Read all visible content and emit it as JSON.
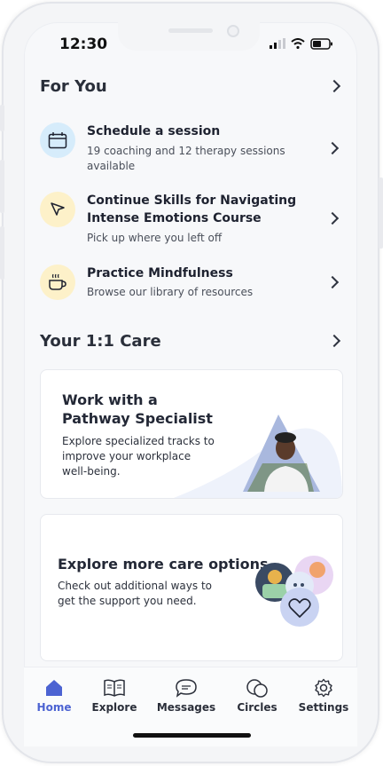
{
  "status": {
    "time": "12:30"
  },
  "for_you": {
    "title": "For You",
    "items": [
      {
        "icon": "calendar-icon",
        "title": "Schedule a session",
        "subtitle": "19 coaching and 12 therapy sessions available",
        "icon_bg": "#d6ecfb"
      },
      {
        "icon": "cursor-icon",
        "title": "Continue Skills for Navigating Intense Emotions Course",
        "subtitle": "Pick up where you left off",
        "icon_bg": "#fdf1c9"
      },
      {
        "icon": "tea-cup-icon",
        "title": "Practice Mindfulness",
        "subtitle": "Browse our library of resources",
        "icon_bg": "#fdf1c9"
      }
    ]
  },
  "care": {
    "title": "Your 1:1 Care",
    "cards": [
      {
        "title": "Work with a Pathway Specialist",
        "subtitle": "Explore specialized tracks to improve your workplace well-being."
      },
      {
        "title": "Explore more care options",
        "subtitle": "Check out additional ways to get the support you need."
      }
    ]
  },
  "tabs": [
    {
      "label": "Home",
      "icon": "home-icon",
      "active": true
    },
    {
      "label": "Explore",
      "icon": "book-icon",
      "active": false
    },
    {
      "label": "Messages",
      "icon": "chat-icon",
      "active": false
    },
    {
      "label": "Circles",
      "icon": "circles-icon",
      "active": false
    },
    {
      "label": "Settings",
      "icon": "gear-icon",
      "active": false
    }
  ],
  "colors": {
    "accent": "#4c63d2",
    "blue_tint": "#d6ecfb",
    "yellow_tint": "#fdf1c9"
  }
}
